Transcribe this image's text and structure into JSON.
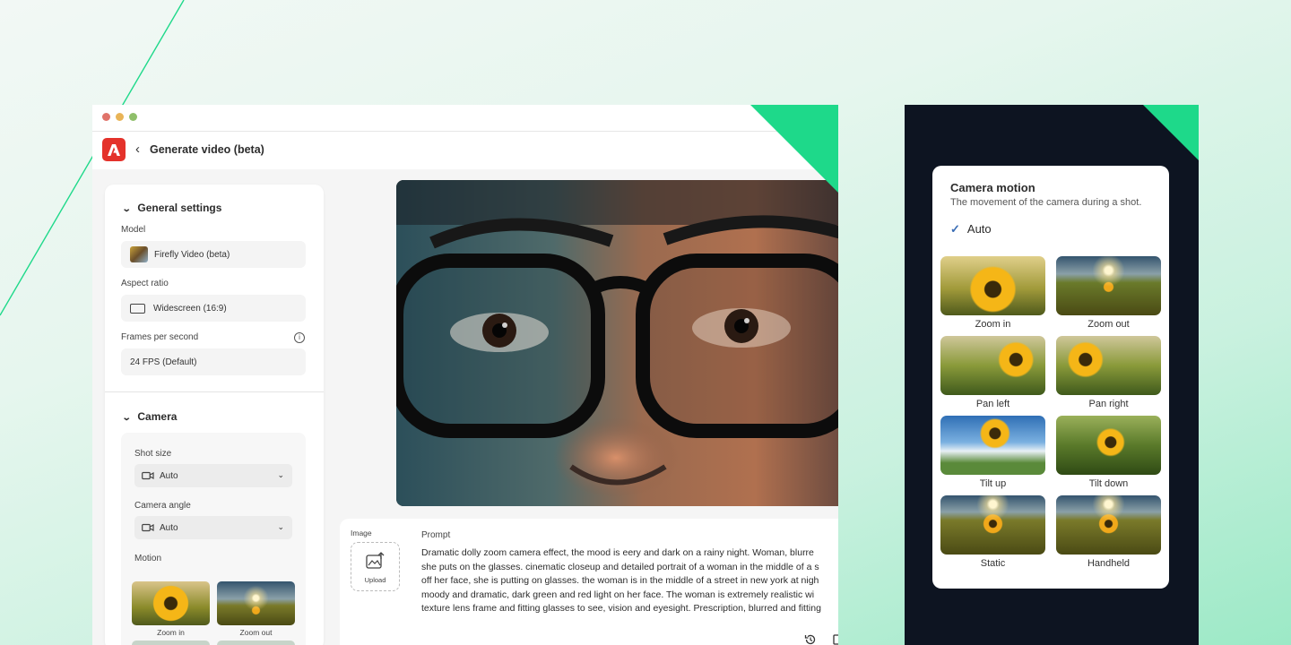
{
  "app": {
    "title": "Generate video (beta)"
  },
  "general": {
    "header": "General settings",
    "model_label": "Model",
    "model_value": "Firefly Video (beta)",
    "aspect_label": "Aspect ratio",
    "aspect_value": "Widescreen (16:9)",
    "fps_label": "Frames per second",
    "fps_value": "24 FPS (Default)"
  },
  "camera": {
    "header": "Camera",
    "shot_label": "Shot size",
    "shot_value": "Auto",
    "angle_label": "Camera angle",
    "angle_value": "Auto",
    "motion_label": "Motion",
    "thumbs": [
      "Zoom in",
      "Zoom out"
    ]
  },
  "prompt": {
    "image_label": "Image",
    "upload_label": "Upload",
    "label": "Prompt",
    "lines": [
      "Dramatic dolly zoom camera effect, the mood is eery and dark on a rainy night. Woman, blurre",
      "she puts on the glasses. cinematic closeup and detailed portrait of a woman in the middle of a s",
      "off her face, she is putting on glasses. the woman is in the middle of a street in new york at nigh",
      "moody and dramatic, dark green and red light on her face. The woman is extremely realistic wi",
      "texture lens frame and fitting glasses to see, vision and eyesight. Prescription, blurred and fitting"
    ]
  },
  "motion_card": {
    "title": "Camera motion",
    "subtitle": "The movement of the camera during a shot.",
    "selected": "Auto",
    "options": [
      "Zoom in",
      "Zoom out",
      "Pan left",
      "Pan right",
      "Tilt up",
      "Tilt down",
      "Static",
      "Handheld"
    ]
  },
  "colors": {
    "accent": "#1ed98a",
    "brand_red": "#e4322b",
    "dark_panel": "#0d1421"
  }
}
